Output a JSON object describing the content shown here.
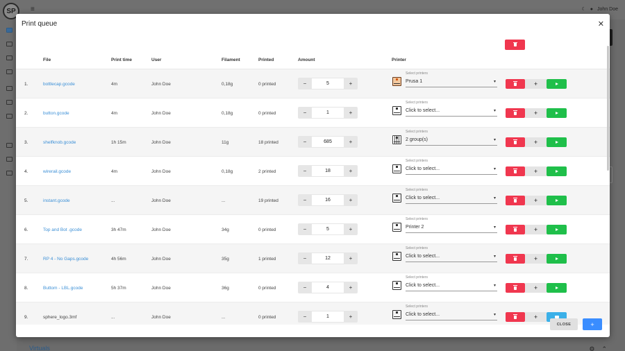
{
  "background": {
    "logo_text": "SP",
    "user_name": "John Doe",
    "virtuals_label": "Virtuals"
  },
  "modal": {
    "title": "Print queue",
    "close_label": "CLOSE",
    "add_label": "+",
    "columns": {
      "file": "File",
      "print_time": "Print time",
      "user": "User",
      "filament": "Filament",
      "printed": "Printed",
      "amount": "Amount",
      "printer": "Printer"
    },
    "select_label": "Select printers",
    "rows": [
      {
        "index": "1.",
        "file": "bottlecap.gcode",
        "file_link": true,
        "print_time": "4m",
        "user": "John Doe",
        "filament": "0,18g",
        "printed": "0 printed",
        "amount": "5",
        "printer_value": "Prusa 1",
        "printer_icon": "prusa-icon",
        "action_icon": "play-icon"
      },
      {
        "index": "2.",
        "file": "button.gcode",
        "file_link": true,
        "print_time": "4m",
        "user": "John Doe",
        "filament": "0,18g",
        "printed": "0 printed",
        "amount": "1",
        "printer_value": "Click to select...",
        "printer_icon": "printer-icon",
        "action_icon": "play-icon"
      },
      {
        "index": "3.",
        "file": "shelfknob.gcode",
        "file_link": true,
        "print_time": "1h 15m",
        "user": "John Doe",
        "filament": "11g",
        "printed": "18 printed",
        "amount": "685",
        "printer_value": "2 group(s)",
        "printer_icon": "printer-group-icon",
        "action_icon": "play-icon"
      },
      {
        "index": "4.",
        "file": "wirerail.gcode",
        "file_link": true,
        "print_time": "4m",
        "user": "John Doe",
        "filament": "0,18g",
        "printed": "2 printed",
        "amount": "18",
        "printer_value": "Click to select...",
        "printer_icon": "printer-icon",
        "action_icon": "play-icon"
      },
      {
        "index": "5.",
        "file": "instant.gcode",
        "file_link": true,
        "print_time": "...",
        "user": "John Doe",
        "filament": "...",
        "printed": "19 printed",
        "amount": "16",
        "printer_value": "Click to select...",
        "printer_icon": "printer-icon",
        "action_icon": "play-icon"
      },
      {
        "index": "6.",
        "file": "Top and Bot .gcode",
        "file_link": true,
        "print_time": "3h 47m",
        "user": "John Doe",
        "filament": "34g",
        "printed": "0 printed",
        "amount": "5",
        "printer_value": "Printer 2",
        "printer_icon": "printer-icon",
        "action_icon": "play-icon"
      },
      {
        "index": "7.",
        "file": "RP 4 - No Gaps.gcode",
        "file_link": true,
        "print_time": "4h 56m",
        "user": "John Doe",
        "filament": "35g",
        "printed": "1 printed",
        "amount": "12",
        "printer_value": "Click to select...",
        "printer_icon": "printer-icon",
        "action_icon": "play-icon"
      },
      {
        "index": "8.",
        "file": "Buttom - LBL.gcode",
        "file_link": true,
        "print_time": "5h 37m",
        "user": "John Doe",
        "filament": "36g",
        "printed": "0 printed",
        "amount": "4",
        "printer_value": "Click to select...",
        "printer_icon": "printer-icon",
        "action_icon": "play-icon"
      },
      {
        "index": "9.",
        "file": "sphere_logo.3mf",
        "file_link": false,
        "print_time": "...",
        "user": "John Doe",
        "filament": "...",
        "printed": "0 printed",
        "amount": "1",
        "printer_value": "Click to select...",
        "printer_icon": "printer-icon",
        "action_icon": "queue-icon"
      }
    ]
  },
  "colors": {
    "delete": "#f0374f",
    "play": "#1fbf4a",
    "queue": "#3bb0e8",
    "primary": "#3a8dff",
    "link": "#3b8fd6"
  }
}
